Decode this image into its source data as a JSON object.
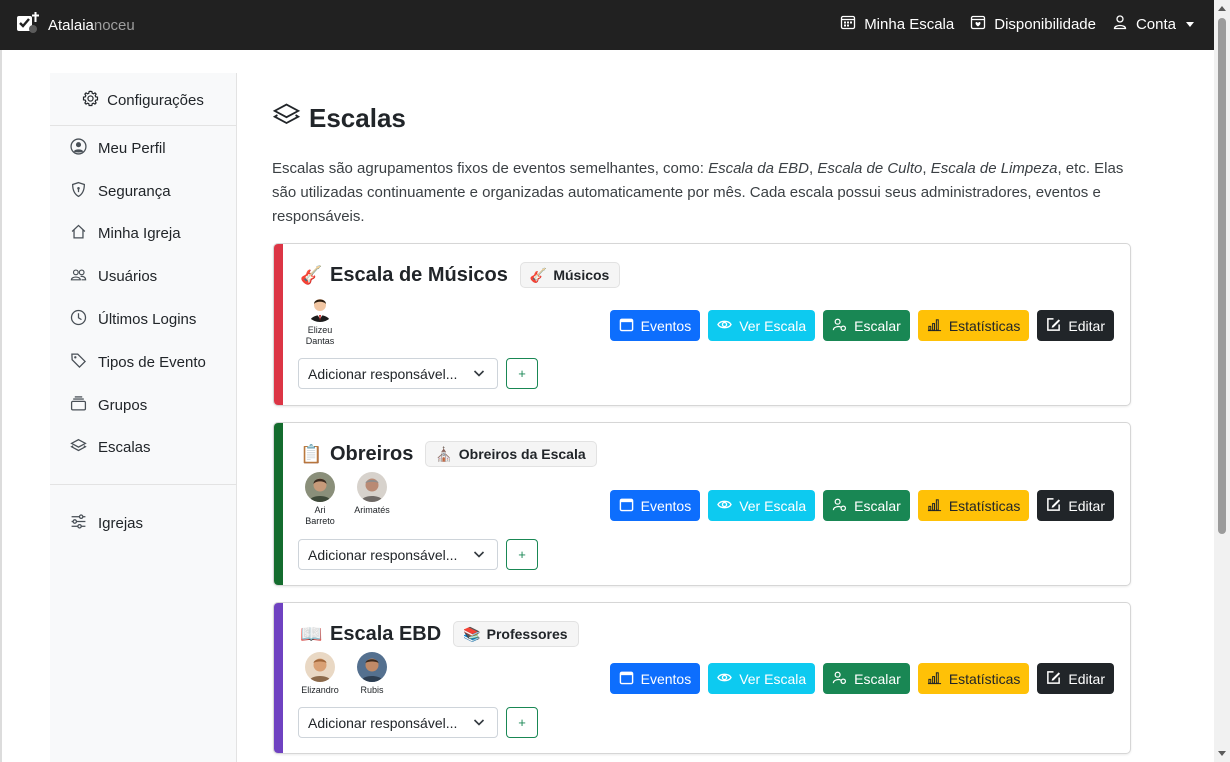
{
  "brand": {
    "name_bold": "Atalaia",
    "name_light": "noceu"
  },
  "nav": {
    "minha_escala": "Minha Escala",
    "disponibilidade": "Disponibilidade",
    "conta": "Conta"
  },
  "sidebar": {
    "header": "Configurações",
    "items": [
      {
        "label": "Meu Perfil",
        "icon": "user-circle-icon"
      },
      {
        "label": "Segurança",
        "icon": "shield-icon"
      },
      {
        "label": "Minha Igreja",
        "icon": "home-icon"
      },
      {
        "label": "Usuários",
        "icon": "users-icon"
      },
      {
        "label": "Últimos Logins",
        "icon": "clock-icon"
      },
      {
        "label": "Tipos de Evento",
        "icon": "tag-icon"
      },
      {
        "label": "Grupos",
        "icon": "stack-icon"
      },
      {
        "label": "Escalas",
        "icon": "layers-icon"
      }
    ],
    "igrejas": "Igrejas"
  },
  "page": {
    "title": "Escalas",
    "intro_1": "Escalas são agrupamentos fixos de eventos semelhantes, como: ",
    "intro_em1": "Escala da EBD",
    "intro_sep1": ", ",
    "intro_em2": "Escala de Culto",
    "intro_sep2": ", ",
    "intro_em3": "Escala de Limpeza",
    "intro_2": ", etc. Elas são utilizadas continuamente e organizadas automaticamente por mês. Cada escala possui seus administradores, eventos e responsáveis."
  },
  "buttons": {
    "eventos": "Eventos",
    "ver_escala": "Ver Escala",
    "escalar": "Escalar",
    "estatisticas": "Estatísticas",
    "editar": "Editar",
    "add": "+"
  },
  "select_placeholder": "Adicionar responsável...",
  "escalas": [
    {
      "emoji": "🎸",
      "name": "Escala de Músicos",
      "accent": "#dc3545",
      "group": {
        "emoji": "🎸",
        "name": "Músicos"
      },
      "members": [
        {
          "line1": "Elizeu",
          "line2": "Dantas"
        }
      ]
    },
    {
      "emoji": "📋",
      "name": "Obreiros",
      "accent": "#198754",
      "group": {
        "emoji": "⛪",
        "name": "Obreiros da Escala"
      },
      "members": [
        {
          "line1": "Ari",
          "line2": "Barreto"
        },
        {
          "line1": "Arimatés",
          "line2": ""
        }
      ]
    },
    {
      "emoji": "📖",
      "name": "Escala EBD",
      "accent": "#6f42c1",
      "group": {
        "emoji": "📚",
        "name": "Professores"
      },
      "members": [
        {
          "line1": "Elizandro",
          "line2": ""
        },
        {
          "line1": "Rubis",
          "line2": ""
        }
      ]
    }
  ],
  "colors": {
    "navbar": "#212121",
    "primary": "#0d6efd",
    "info": "#0dcaf0",
    "success": "#198754",
    "warning": "#ffc107",
    "dark": "#212529"
  }
}
